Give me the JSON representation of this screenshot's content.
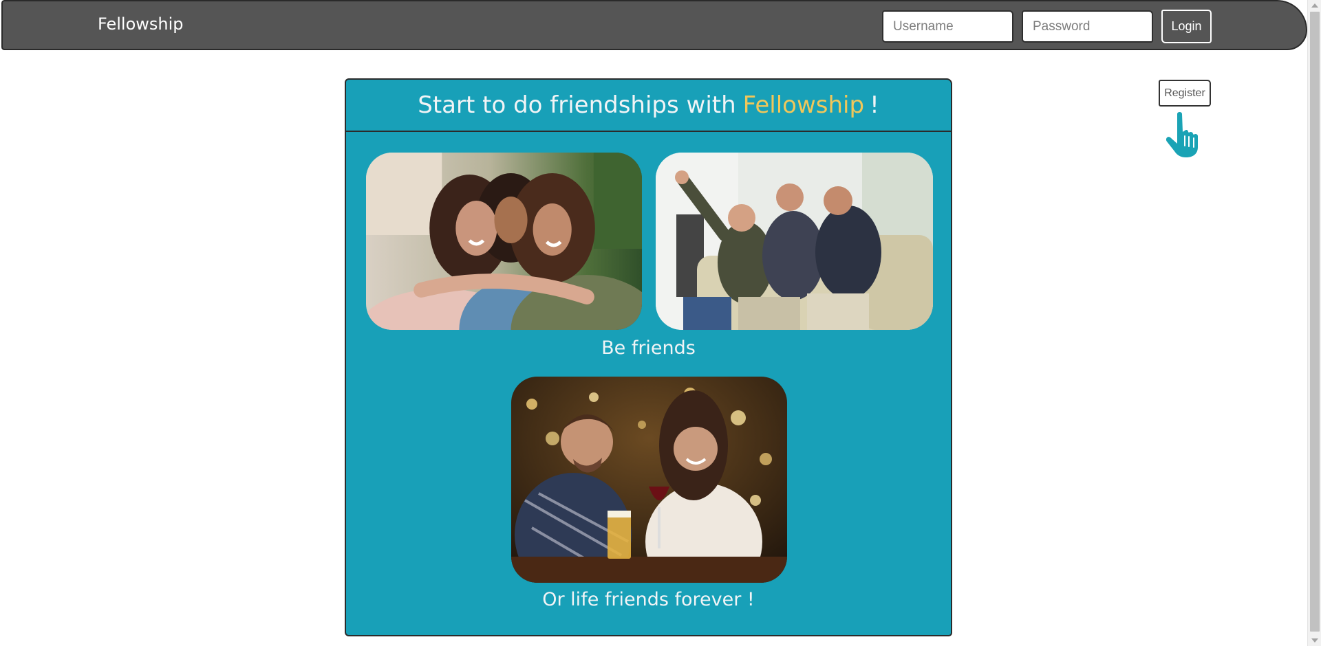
{
  "navbar": {
    "brand": "Fellowship",
    "username_placeholder": "Username",
    "password_placeholder": "Password",
    "login_label": "Login"
  },
  "aside": {
    "register_label": "Register",
    "pointer_icon": "hand-pointer-icon"
  },
  "card": {
    "title_prefix": "Start to do friendships with",
    "title_brand": "Fellowship",
    "title_suffix": "!",
    "caption_1": "Be friends",
    "caption_2": "Or life friends forever !"
  },
  "colors": {
    "navbar_bg": "#555555",
    "card_bg": "#18a0b8",
    "brand_accent": "#f0c75a",
    "pointer_icon": "#1aa3b5"
  }
}
